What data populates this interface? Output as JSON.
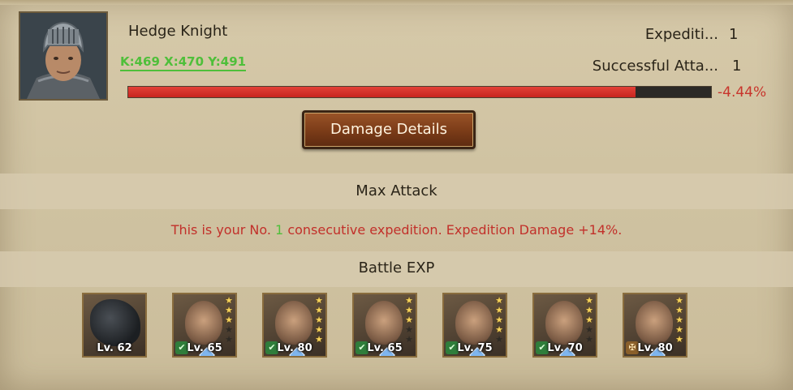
{
  "header": {
    "name": "Hedge Knight",
    "coords": "K:469 X:470 Y:491"
  },
  "stats": [
    {
      "label": "Expediti...",
      "value": "1"
    },
    {
      "label": "Successful Atta...",
      "value": "1"
    }
  ],
  "health_bar": {
    "fill_percent": 87,
    "label": "-4.44%",
    "color": "#e0362b"
  },
  "damage_button": {
    "label": "Damage Details"
  },
  "max_attack": {
    "title": "Max Attack",
    "message_prefix": "This is your No. ",
    "message_num": "1",
    "message_suffix": " consecutive expedition. Expedition Damage +14%."
  },
  "battle_exp": {
    "title": "Battle EXP",
    "heroes": [
      {
        "level": "Lv. 62",
        "kind": "dragon",
        "stars": 0,
        "badge": ""
      },
      {
        "level": "Lv. 65",
        "kind": "hero",
        "stars": 3,
        "badge": "green"
      },
      {
        "level": "Lv. 80",
        "kind": "hero",
        "stars": 5,
        "badge": "green"
      },
      {
        "level": "Lv. 65",
        "kind": "hero",
        "stars": 3,
        "badge": "green"
      },
      {
        "level": "Lv. 75",
        "kind": "hero",
        "stars": 4,
        "badge": "green"
      },
      {
        "level": "Lv. 70",
        "kind": "hero",
        "stars": 3,
        "badge": "green"
      },
      {
        "level": "Lv. 80",
        "kind": "hero",
        "stars": 5,
        "badge": "gold"
      }
    ]
  }
}
